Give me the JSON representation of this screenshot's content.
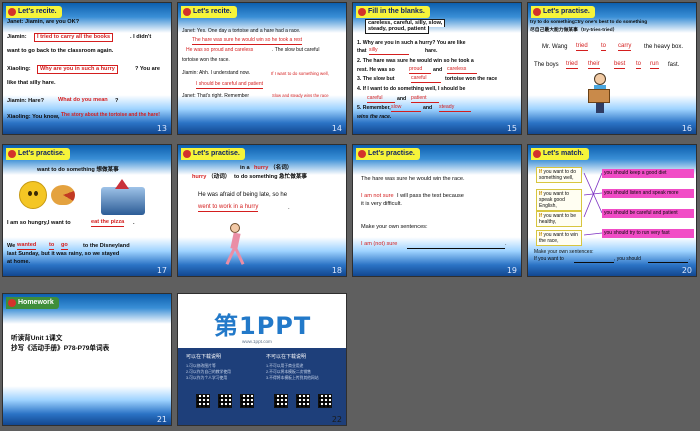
{
  "slides": [
    {
      "num": "13",
      "badge": "Let's recite.",
      "lines": [
        "Janet: Jiamin, are you OK?",
        "Jiamin:",
        "I tried to carry all the books",
        ". I didn't",
        "want to go back to the classroom again.",
        "Xiaoling:",
        "Why are you in such a hurry",
        "? You are",
        "like  that silly hare.",
        "Jiamin:  Hare?",
        "What do you mean",
        "?",
        "Xiaoling: You know,",
        "The story about the tortoise and the hare!"
      ]
    },
    {
      "num": "14",
      "badge": "Let's recite.",
      "lines": [
        "Janet: Yes.  One day a tortoise and a hare had a race.",
        "The hare was sure he would win so he took a rest",
        "He was so proud and careless",
        ". The  slow but careful",
        "tortoise won the race.",
        "Jiamin: Ahh. I understand now.",
        "If I want to do something well,",
        "I should be careful and patient",
        "Janet: That's right. Remember",
        "Slow and steady wins the race"
      ]
    },
    {
      "num": "15",
      "badge": "Fill in the blanks.",
      "words": "careless, careful, silly, slow,",
      "words2": "steady, proud, patient",
      "lines": [
        "1. Why are you in such a hurry? You are like",
        "that",
        "silly",
        "hare.",
        "2. The hare was sure he would win so he took a",
        "rest. He was so",
        "proud",
        "and",
        "careless",
        "3. The slow but",
        "careful",
        "tortoise won the race",
        "4. If I want to do something well, I should be",
        "careful",
        "and",
        "patient",
        "5. Remember,",
        "slow",
        "and",
        "steady",
        "wins the race."
      ]
    },
    {
      "num": "16",
      "badge": "Let's practise.",
      "lines": [
        "try to do something=try one's best to do something",
        "尽自己最大能力做某事（try-tries-tried）",
        "Mr. Wang",
        "tried",
        "to",
        "carry",
        "the heavy box.",
        "The boys",
        "tried",
        "their",
        "best",
        "to",
        "run",
        "fast."
      ]
    },
    {
      "num": "17",
      "badge": "Let's practise.",
      "lines": [
        "want to do something 想做某事",
        "I am so hungry,I want to",
        "eat the pizza",
        ".",
        "We",
        "wanted",
        "to",
        "go",
        "to the Disneyland",
        "last Sunday, but it was rainy, so we stayed",
        "at home."
      ]
    },
    {
      "num": "18",
      "badge": "Let's practise.",
      "lines": [
        "in a",
        "hurry",
        "（名词）",
        "hurry",
        "（动词）",
        "to do something 急忙做某事",
        "He was afraid of being late, so he",
        "went to work in a hurry",
        "."
      ]
    },
    {
      "num": "19",
      "badge": "Let's practise.",
      "lines": [
        "The hare was sure he would win the race.",
        "I am not sure",
        "I will pass the test because",
        "it is very difficult.",
        "Make your own sentences:",
        "I am (not) sure",
        "."
      ]
    },
    {
      "num": "20",
      "badge": "Let's match.",
      "left": [
        {
          "if": "If",
          "text": "you want to do something well,"
        },
        {
          "if": "If",
          "text": "you want to speak good English,"
        },
        {
          "if": "If",
          "text": "you want to be healthy,"
        },
        {
          "if": "If",
          "text": "you want to win the race,"
        }
      ],
      "right": [
        "you should keep a good diet",
        "you should listen and speak more",
        "you should be careful and patient",
        "you should try to run very fast"
      ],
      "footer1": "Make your own sentences:",
      "footer2": "If you want to",
      "footer3": ", you should",
      "footer4": "."
    },
    {
      "num": "21",
      "badge": "Homework",
      "lines": [
        "听读背Unit 1课文",
        "抄写《活动手册》P78-P79单词表"
      ]
    },
    {
      "num": "22",
      "logo": "第1PPT",
      "logo_sub": "www.1ppt.com",
      "left_title": "可以在下载说明",
      "right_title": "不可以在下载说明",
      "left_lines": [
        "1.可以修改图片等",
        "2.可以作为自己的教学使用",
        "3.可以作为个人学习使用"
      ],
      "right_lines": [
        "1.不可以用于商业用途",
        "2.不可以将本模板二次销售",
        "3.不得将本模板上传到其他网站"
      ]
    }
  ]
}
